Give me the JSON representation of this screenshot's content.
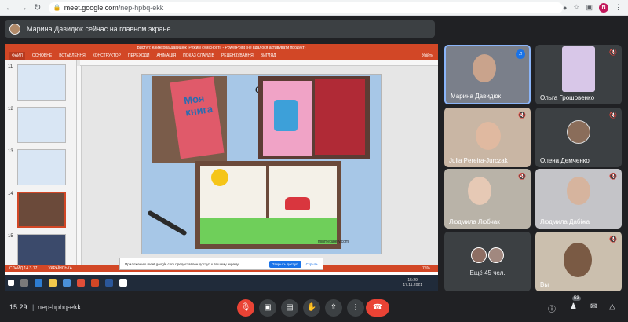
{
  "browser": {
    "url_host": "meet.google.com",
    "url_path": "/nep-hpbq-ekk",
    "profile_initial": "N"
  },
  "banner": {
    "text": "Марина Давидюк сейчас на главном экране"
  },
  "powerpoint": {
    "title": "Виступ: Книжкова Давидюк [Режим сумісності] - PowerPoint (не вдалося активувати продукт)",
    "ribbon_tabs": [
      "ФАЙЛ",
      "ОСНОВНЕ",
      "ВСТАВЛЕННЯ",
      "КОНСТРУКТОР",
      "ПЕРЕХОДИ",
      "АНІМАЦІЯ",
      "ПОКАЗ СЛАЙДІВ",
      "РЕЦЕНЗУВАННЯ",
      "ВИГЛЯД"
    ],
    "user": "Увійти",
    "slide_numbers": [
      "11",
      "12",
      "13",
      "14",
      "15"
    ],
    "slide_title_fragment": "СЛ",
    "book_text": "Моя книга",
    "watermark": "minmegalery.com",
    "notes": "Нотатки до слайд",
    "status_slide": "СЛАЙД 14 З 17",
    "status_lang": "УКРАЇНСЬКА",
    "zoom": "75%"
  },
  "toast": {
    "text": "Приложению meet.google.com предоставлен доступ к вашему экрану.",
    "share_button": "Закрыть доступ",
    "hide_button": "Скрыть"
  },
  "taskbar": {
    "time": "15:29",
    "date": "17.11.2021"
  },
  "participants": [
    {
      "name": "Марина Давидюк",
      "speaking": true
    },
    {
      "name": "Ольга Грошовенко",
      "muted": true
    },
    {
      "name": "Julia Pereira-Jurczak",
      "muted": true
    },
    {
      "name": "Олена Демченко",
      "muted": true
    },
    {
      "name": "Людмила Любчак",
      "muted": true
    },
    {
      "name": "Людмила Дабіжа",
      "muted": true
    },
    {
      "name": "",
      "more": "Ещё 45 чел."
    },
    {
      "name": "Вы",
      "muted": true
    }
  ],
  "bottom": {
    "time": "15:29",
    "separator": "|",
    "code": "nep-hpbq-ekk",
    "people_count": "53"
  },
  "colors": {
    "accent": "#1a73e8",
    "danger": "#ea4335",
    "ppt": "#d24726"
  }
}
